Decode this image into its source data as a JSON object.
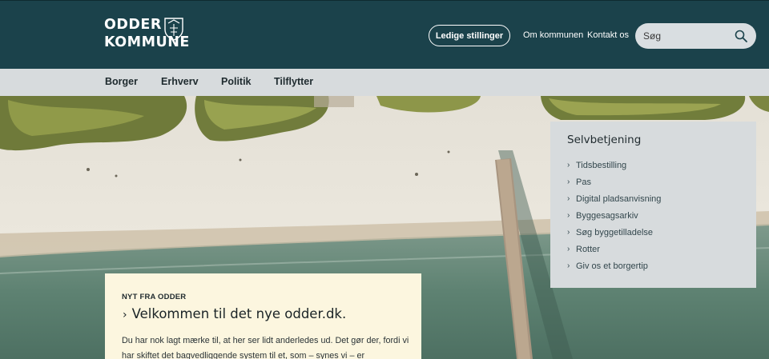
{
  "header": {
    "logo": {
      "line1": "ODDER",
      "line2": "KOMMUNE"
    },
    "jobs_button": "Ledige stillinger",
    "links": {
      "about": "Om kommunen",
      "contact": "Kontakt os"
    },
    "search": {
      "placeholder": "Søg"
    }
  },
  "nav": {
    "items": [
      "Borger",
      "Erhverv",
      "Politik",
      "Tilflytter"
    ]
  },
  "selfservice": {
    "title": "Selvbetjening",
    "items": [
      "Tidsbestilling",
      "Pas",
      "Digital pladsanvisning",
      "Byggesagsarkiv",
      "Søg byggetilladelse",
      "Rotter",
      "Giv os et borgertip"
    ]
  },
  "news": {
    "eyebrow": "NYT FRA ODDER",
    "title": "Velkommen til det nye odder.dk.",
    "body": "Du har nok lagt mærke til, at her ser lidt anderledes ud. Det gør der, fordi vi har skiftet det bagvedliggende system til et, som – synes vi – er"
  },
  "colors": {
    "header_bg": "#1b424b",
    "nav_bg": "#d7dbdd",
    "panel_bg": "#d7dbdd",
    "card_bg": "#fcf6df"
  }
}
